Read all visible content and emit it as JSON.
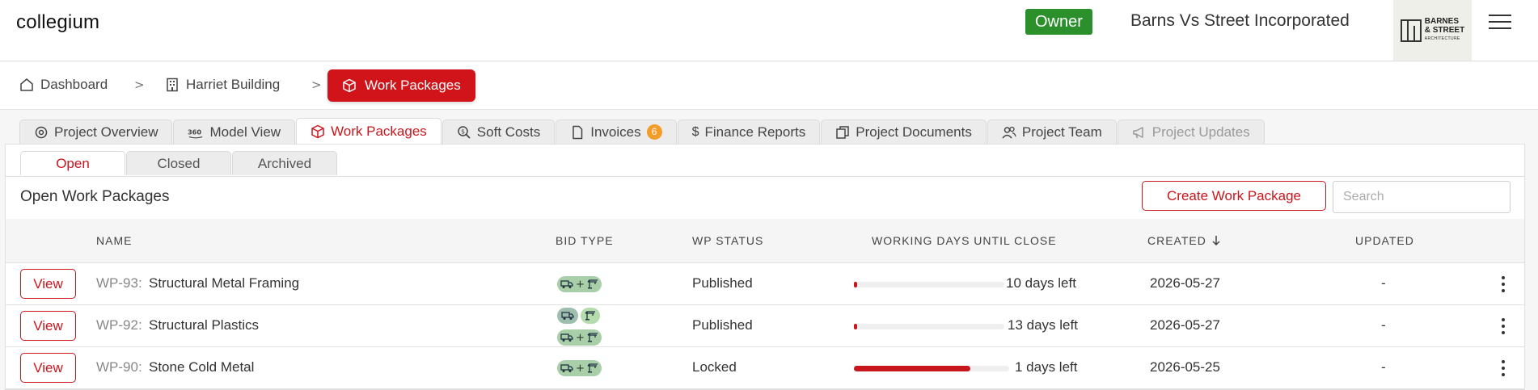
{
  "app": {
    "logo": "collegium"
  },
  "header": {
    "role_badge": "Owner",
    "company_name": "Barns Vs Street Incorporated",
    "company_logo": {
      "line1": "BARNES",
      "line2": "& STREET",
      "line3": "ARCHITECTURE"
    },
    "menu_icon": "hamburger-icon",
    "colors": {
      "role_badge": "#2b8f2b"
    }
  },
  "breadcrumb": {
    "items": [
      {
        "label": "Dashboard",
        "icon": "home-icon"
      },
      {
        "label": "Harriet Building",
        "icon": "building-icon"
      },
      {
        "label": "Work Packages",
        "icon": "cube-icon"
      }
    ],
    "separator": ">",
    "colors": {
      "active": "#d0141a"
    }
  },
  "tabs": [
    {
      "label": "Project Overview",
      "icon": "overview-icon"
    },
    {
      "label": "Model View",
      "icon": "360-icon"
    },
    {
      "label": "Work Packages",
      "icon": "cube-icon",
      "active": true
    },
    {
      "label": "Soft Costs",
      "icon": "search-dollar-icon"
    },
    {
      "label": "Invoices",
      "icon": "file-icon",
      "badge": "6"
    },
    {
      "label": "Finance Reports",
      "icon": "dollar-icon"
    },
    {
      "label": "Project Documents",
      "icon": "documents-icon"
    },
    {
      "label": "Project Team",
      "icon": "team-icon"
    },
    {
      "label": "Project Updates",
      "icon": "megaphone-icon",
      "disabled": true
    }
  ],
  "subtabs": [
    {
      "label": "Open",
      "active": true
    },
    {
      "label": "Closed"
    },
    {
      "label": "Archived"
    }
  ],
  "section": {
    "title": "Open Work Packages",
    "create_button": "Create Work Package",
    "search_placeholder": "Search"
  },
  "table": {
    "columns": [
      "NAME",
      "BID TYPE",
      "WP STATUS",
      "WORKING DAYS UNTIL CLOSE",
      "CREATED",
      "UPDATED"
    ],
    "sort_indicator": "arrow-down-icon",
    "view_label": "View",
    "bid_plus": "+",
    "rows": [
      {
        "id": "WP-93:",
        "name": "Structural Metal Framing",
        "bid_type": "combined",
        "status": "Published",
        "progress": 0.02,
        "days_left": "10 days left",
        "created": "2026-05-27",
        "updated": "-"
      },
      {
        "id": "WP-92:",
        "name": "Structural Plastics",
        "bid_type": "split+combined",
        "status": "Published",
        "progress": 0.01,
        "days_left": "13 days left",
        "created": "2026-05-27",
        "updated": "-"
      },
      {
        "id": "WP-90:",
        "name": "Stone Cold Metal",
        "bid_type": "combined",
        "status": "Locked",
        "progress": 0.75,
        "days_left": "1 days left",
        "created": "2026-05-25",
        "updated": "-"
      }
    ],
    "colors": {
      "accent": "#c8161d",
      "bid_green": "#b4dcac",
      "bid_gray": "#9fbfae",
      "invoice_badge": "#f39c2a"
    }
  }
}
